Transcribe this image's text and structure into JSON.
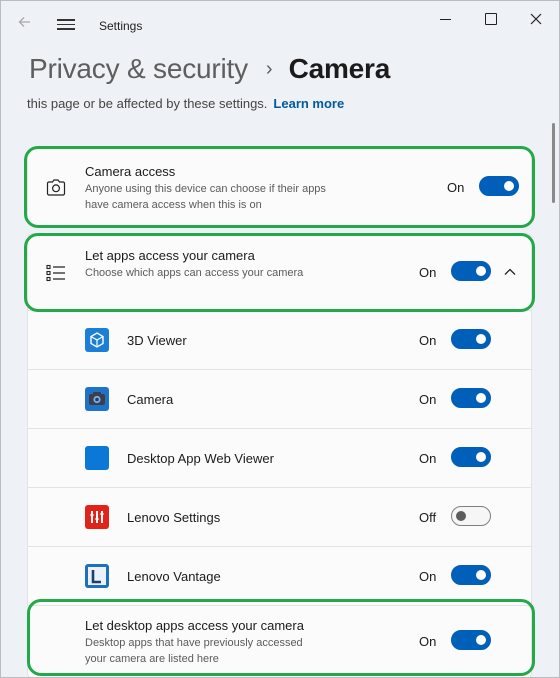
{
  "window": {
    "title": "Settings"
  },
  "breadcrumb": {
    "parent": "Privacy & security",
    "separator": "›",
    "current": "Camera"
  },
  "intro": {
    "text": "this page or be affected by these settings.",
    "link": "Learn more"
  },
  "camera_access": {
    "icon": "camera-icon",
    "title": "Camera access",
    "description": "Anyone using this device can choose if their apps have camera access when this is on",
    "state": "On",
    "enabled": true,
    "highlighted": true
  },
  "apps_access": {
    "icon": "list-icon",
    "title": "Let apps access your camera",
    "description": "Choose which apps can access your camera",
    "state": "On",
    "enabled": true,
    "expanded": true,
    "highlighted": true
  },
  "apps": [
    {
      "name": "3D Viewer",
      "icon": "3d-viewer-icon",
      "state": "On",
      "enabled": true
    },
    {
      "name": "Camera",
      "icon": "camera-app-icon",
      "state": "On",
      "enabled": true
    },
    {
      "name": "Desktop App Web Viewer",
      "icon": "desktop-app-web-viewer-icon",
      "state": "On",
      "enabled": true
    },
    {
      "name": "Lenovo Settings",
      "icon": "lenovo-settings-icon",
      "state": "Off",
      "enabled": false
    },
    {
      "name": "Lenovo Vantage",
      "icon": "lenovo-vantage-icon",
      "state": "On",
      "enabled": true
    }
  ],
  "desktop_apps_access": {
    "title": "Let desktop apps access your camera",
    "description": "Desktop apps that have previously accessed your camera are listed here",
    "state": "On",
    "enabled": true,
    "highlighted": true
  },
  "colors": {
    "accent": "#005fb8",
    "highlight": "#23a94a",
    "link": "#005a9e"
  }
}
